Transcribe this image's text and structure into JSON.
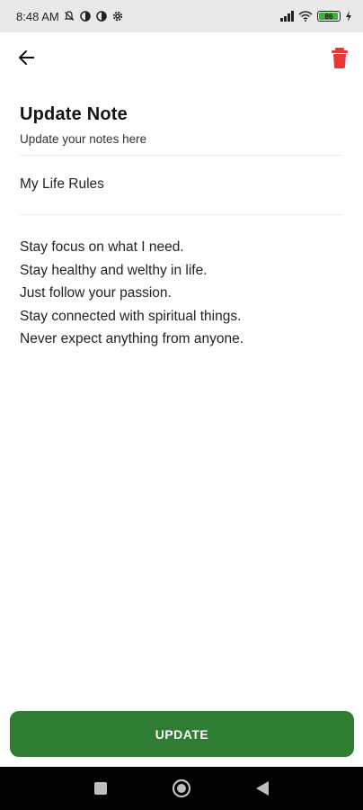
{
  "status_bar": {
    "time": "8:48 AM",
    "battery": "86",
    "network": "4G"
  },
  "header": {
    "title": "Update Note",
    "subtitle": "Update your notes here"
  },
  "note": {
    "title_value": "My Life Rules",
    "body_lines": [
      "Stay focus on what I need.",
      "Stay healthy and welthy in life.",
      "Just follow your passion.",
      "Stay connected with spiritual things.",
      "Never expect anything from anyone."
    ]
  },
  "actions": {
    "update_label": "UPDATE"
  },
  "colors": {
    "accent": "#2e7d32",
    "delete": "#e53935",
    "status_bar_bg": "#e9e9e9"
  },
  "icons": {
    "back": "arrow-left-icon",
    "delete": "trash-icon",
    "nav_recents": "square-icon",
    "nav_home": "circle-icon",
    "nav_back": "triangle-back-icon"
  }
}
